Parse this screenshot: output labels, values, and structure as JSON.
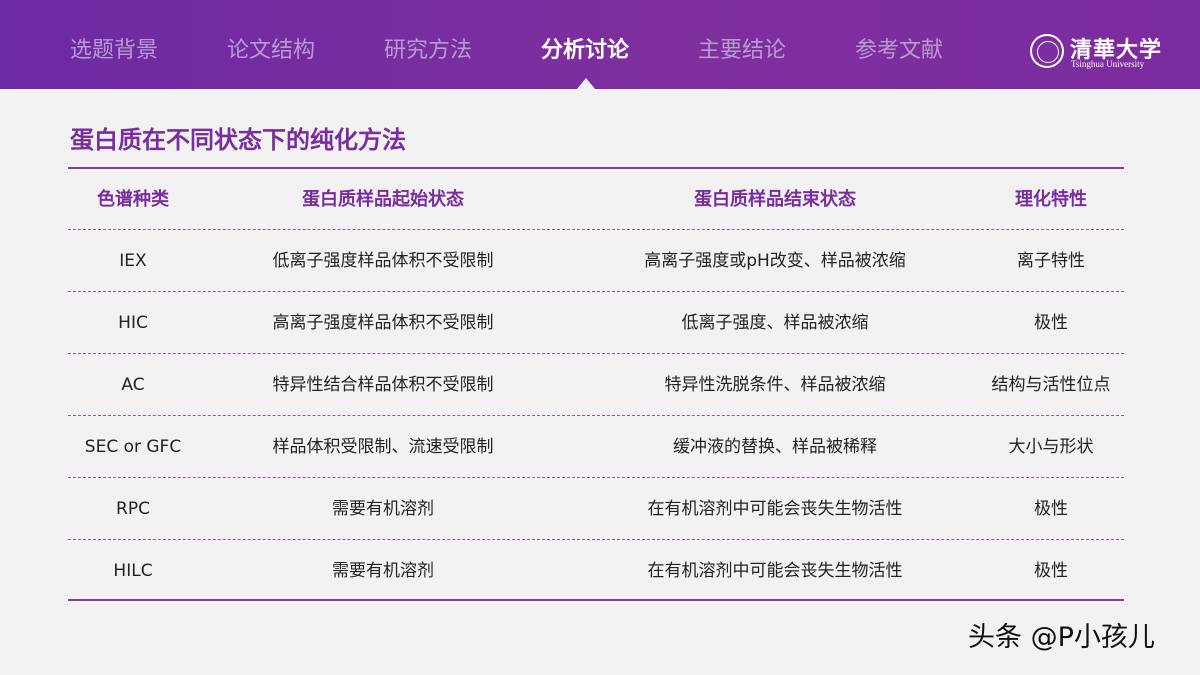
{
  "nav": {
    "items": [
      {
        "label": "选题背景"
      },
      {
        "label": "论文结构"
      },
      {
        "label": "研究方法"
      },
      {
        "label": "分析讨论"
      },
      {
        "label": "主要结论"
      },
      {
        "label": "参考文献"
      }
    ],
    "active_label": "分析讨论"
  },
  "logo": {
    "cn": "清華大学",
    "en": "Tsinghua University"
  },
  "slide": {
    "title": "蛋白质在不同状态下的纯化方法"
  },
  "table": {
    "headers": [
      "色谱种类",
      "蛋白质样品起始状态",
      "蛋白质样品结束状态",
      "理化特性"
    ],
    "rows": [
      [
        "IEX",
        "低离子强度样品体积不受限制",
        "高离子强度或pH改变、样品被浓缩",
        "离子特性"
      ],
      [
        "HIC",
        "高离子强度样品体积不受限制",
        "低离子强度、样品被浓缩",
        "极性"
      ],
      [
        "AC",
        "特异性结合样品体积不受限制",
        "特异性洗脱条件、样品被浓缩",
        "结构与活性位点"
      ],
      [
        "SEC or GFC",
        "样品体积受限制、流速受限制",
        "缓冲液的替换、样品被稀释",
        "大小与形状"
      ],
      [
        "RPC",
        "需要有机溶剂",
        "在有机溶剂中可能会丧失生物活性",
        "极性"
      ],
      [
        "HILC",
        "需要有机溶剂",
        "在有机溶剂中可能会丧失生物活性",
        "极性"
      ]
    ]
  },
  "watermark": "头条 @P小孩儿",
  "colors": {
    "accent": "#7a2d9c",
    "topbar_start": "#6c2aa3",
    "topbar_end": "#7b2c9f",
    "nav_inactive": "#b99ad3",
    "background": "#f2f2f3"
  }
}
